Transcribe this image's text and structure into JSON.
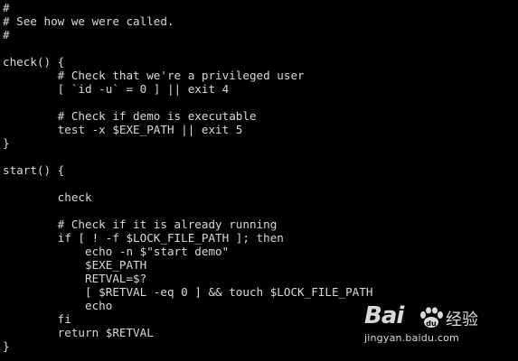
{
  "terminal": {
    "lines": [
      "#",
      "# See how we were called.",
      "#",
      "",
      "check() {",
      "        # Check that we're a privileged user",
      "        [ `id -u` = 0 ] || exit 4",
      "",
      "        # Check if demo is executable",
      "        test -x $EXE_PATH || exit 5",
      "}",
      "",
      "start() {",
      "",
      "        check",
      "",
      "        # Check if it is already running",
      "        if [ ! -f $LOCK_FILE_PATH ]; then",
      "            echo -n $\"start demo\"",
      "            $EXE_PATH",
      "            RETVAL=$?",
      "            [ $RETVAL -eq 0 ] && touch $LOCK_FILE_PATH",
      "            echo",
      "        fi",
      "        return $RETVAL",
      "}"
    ]
  },
  "watermark": {
    "brand_text": "Bai",
    "chinese_text": "经验",
    "url": "jingyan.baidu.com",
    "icon": "baidu-paw-icon"
  }
}
